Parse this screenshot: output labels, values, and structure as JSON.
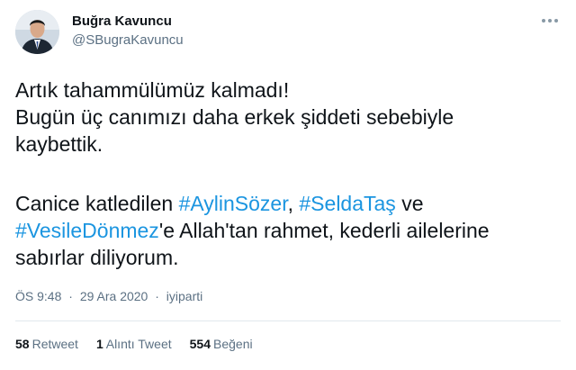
{
  "author": {
    "name": "Buğra Kavuncu",
    "handle": "@SBugraKavuncu"
  },
  "tweet": {
    "line1": "Artık tahammülümüz kalmadı!",
    "line2": "Bugün üç canımızı daha erkek şiddeti sebebiyle",
    "line3": "kaybettik.",
    "line4_prefix": "Canice katledilen ",
    "hashtag1": "#AylinSözer",
    "line4_sep": ", ",
    "hashtag2": "#SeldaTaş",
    "line4_suffix": " ve",
    "hashtag3": "#VesileDönmez",
    "line5_suffix": "'e Allah'tan rahmet, kederli ailelerine",
    "line6": "sabırlar diliyorum."
  },
  "meta": {
    "time": "ÖS 9:48",
    "date": "29 Ara 2020",
    "source": "iyiparti",
    "separator": "·"
  },
  "stats": {
    "retweets_count": "58",
    "retweets_label": "Retweet",
    "quotes_count": "1",
    "quotes_label": "Alıntı Tweet",
    "likes_count": "554",
    "likes_label": "Beğeni"
  },
  "colors": {
    "link": "#1b95e0",
    "secondary_text": "#5b7083",
    "primary_text": "#0f1419",
    "divider": "#e1e8ed"
  },
  "icons": {
    "more": "more-options-icon"
  }
}
